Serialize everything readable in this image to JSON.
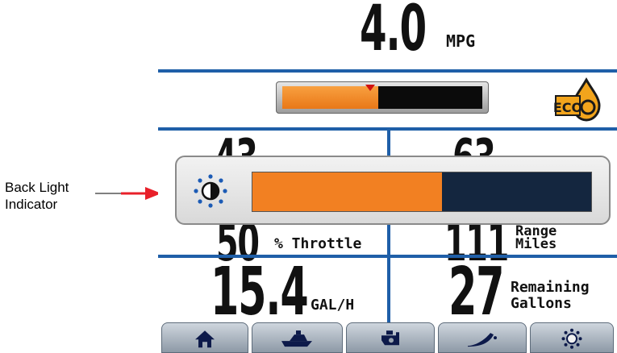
{
  "callout": {
    "text_line1": "Back Light",
    "text_line2": "Indicator"
  },
  "mpg": {
    "value": "4.0",
    "unit": "MPG"
  },
  "economy": {
    "fill_fraction": 0.48,
    "marker_fraction": 0.44,
    "icon": "eco-fuel-drop-icon",
    "icon_label": "ECO"
  },
  "cells": {
    "top_left_value": "43",
    "top_right_value": "63",
    "throttle_value": "50",
    "throttle_unit": "% Throttle",
    "range_value": "111",
    "range_unit_line1": "Range",
    "range_unit_line2": "Miles",
    "fuel_flow_value": "15.4",
    "fuel_flow_unit": "GAL/H",
    "remaining_value": "27",
    "remaining_unit_line1": "Remaining",
    "remaining_unit_line2": "Gallons"
  },
  "backlight": {
    "icon": "brightness-icon",
    "level_fraction": 0.56
  },
  "tabs": [
    {
      "icon": "home-icon"
    },
    {
      "icon": "boat-icon"
    },
    {
      "icon": "engine-icon"
    },
    {
      "icon": "trim-icon"
    },
    {
      "icon": "settings-sun-icon"
    }
  ],
  "colors": {
    "accent": "#1f5fa8",
    "backlight_fill": "#f28022",
    "backlight_empty": "#14263f",
    "arrow": "#e8202a"
  }
}
